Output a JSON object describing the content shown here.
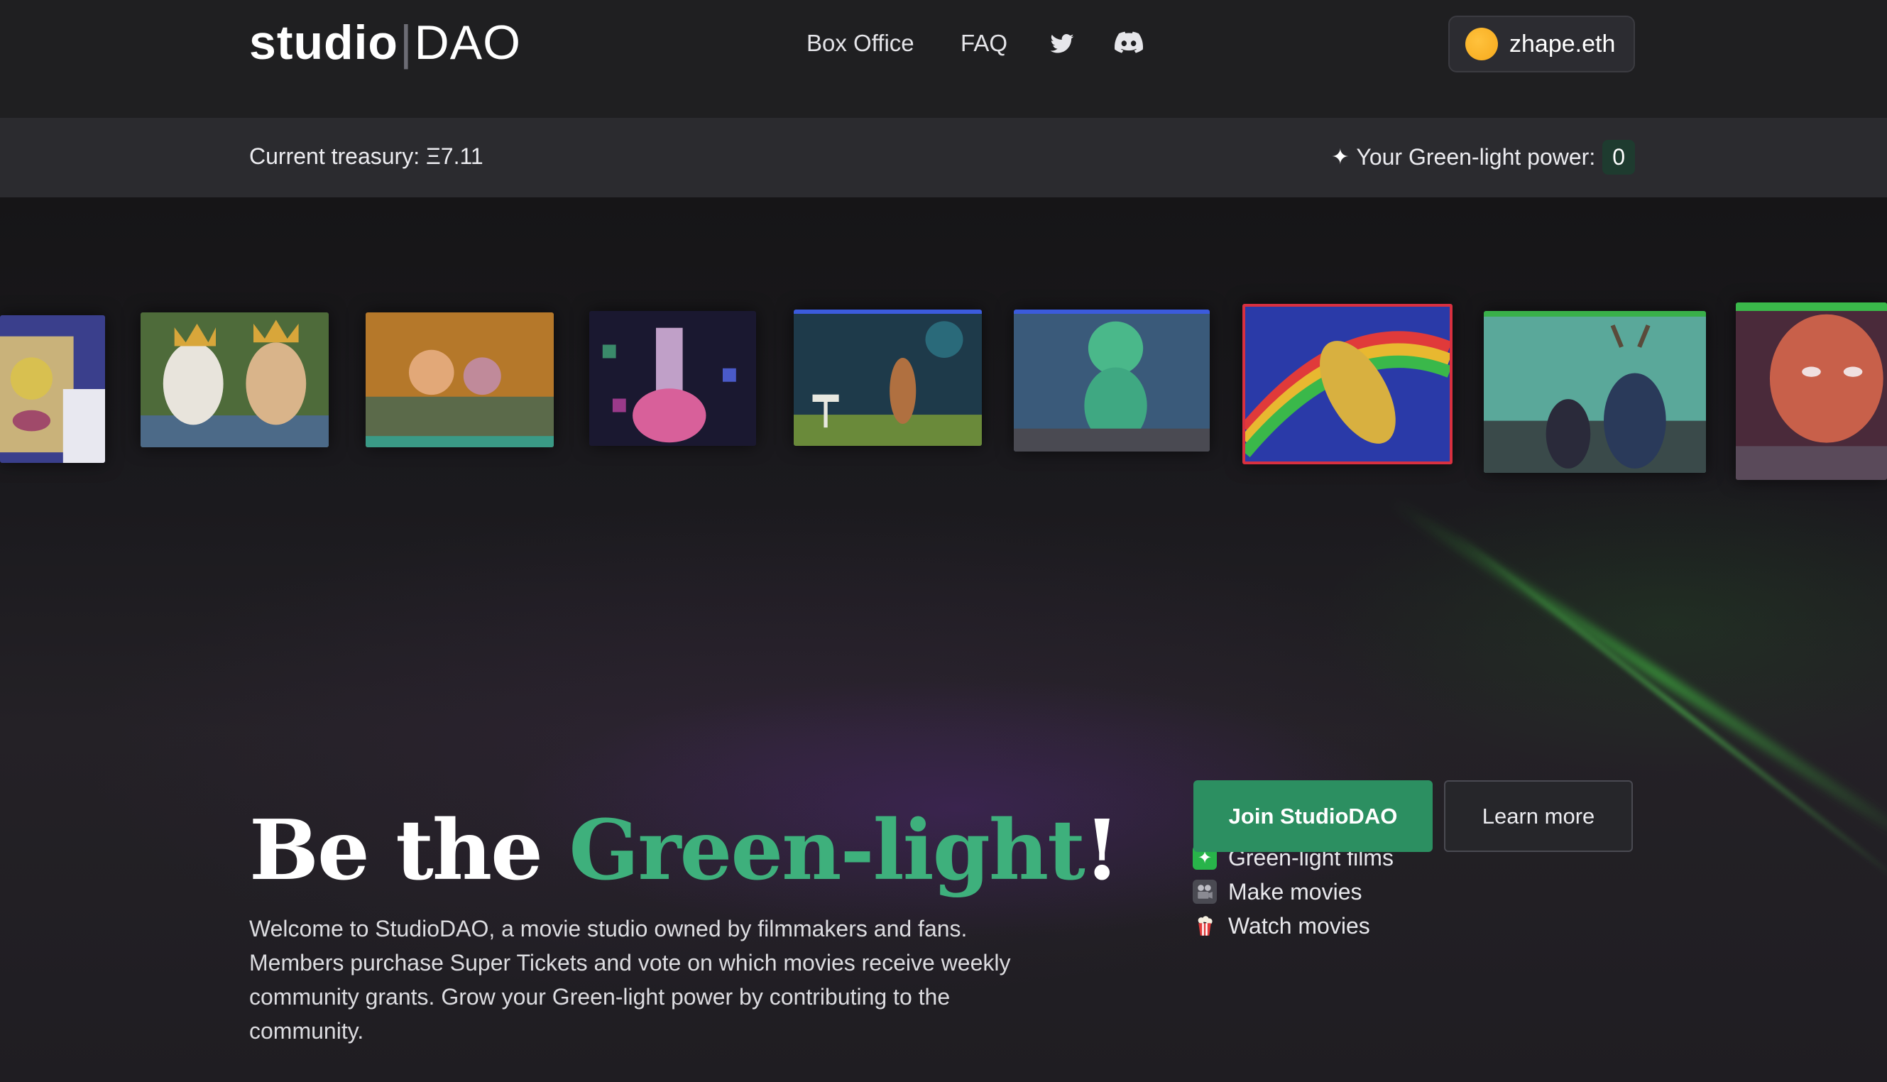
{
  "header": {
    "logo_left": "studio",
    "logo_sep": "|",
    "logo_right": "DAO",
    "nav": {
      "box_office": "Box Office",
      "faq": "FAQ",
      "twitter_icon": "twitter-icon",
      "discord_icon": "discord-icon"
    },
    "account": {
      "name": "zhape.eth",
      "avatar_color": "#f9b42a"
    }
  },
  "subbar": {
    "treasury_label": "Current treasury: Ξ7.11",
    "power_label": "Your Green-light power:",
    "power_value": "0"
  },
  "hero": {
    "headline_start": "Be the ",
    "headline_green": "Green-light",
    "headline_end": "!",
    "intro": "Welcome to StudioDAO, a movie studio owned by filmmakers and fans. Members purchase Super Tickets and vote on which movies receive weekly community grants. Grow your Green-light power by contributing to the community.",
    "features": [
      {
        "icon": "sparkle-icon",
        "label": "Green-light films"
      },
      {
        "icon": "camera-icon",
        "label": "Make movies"
      },
      {
        "icon": "popcorn-icon",
        "label": "Watch movies"
      }
    ],
    "join_button": "Join StudioDAO",
    "learn_button": "Learn more"
  },
  "colors": {
    "accent_green": "#3eb07c",
    "button_green": "#2c8f61",
    "background": "#1f1f21"
  }
}
